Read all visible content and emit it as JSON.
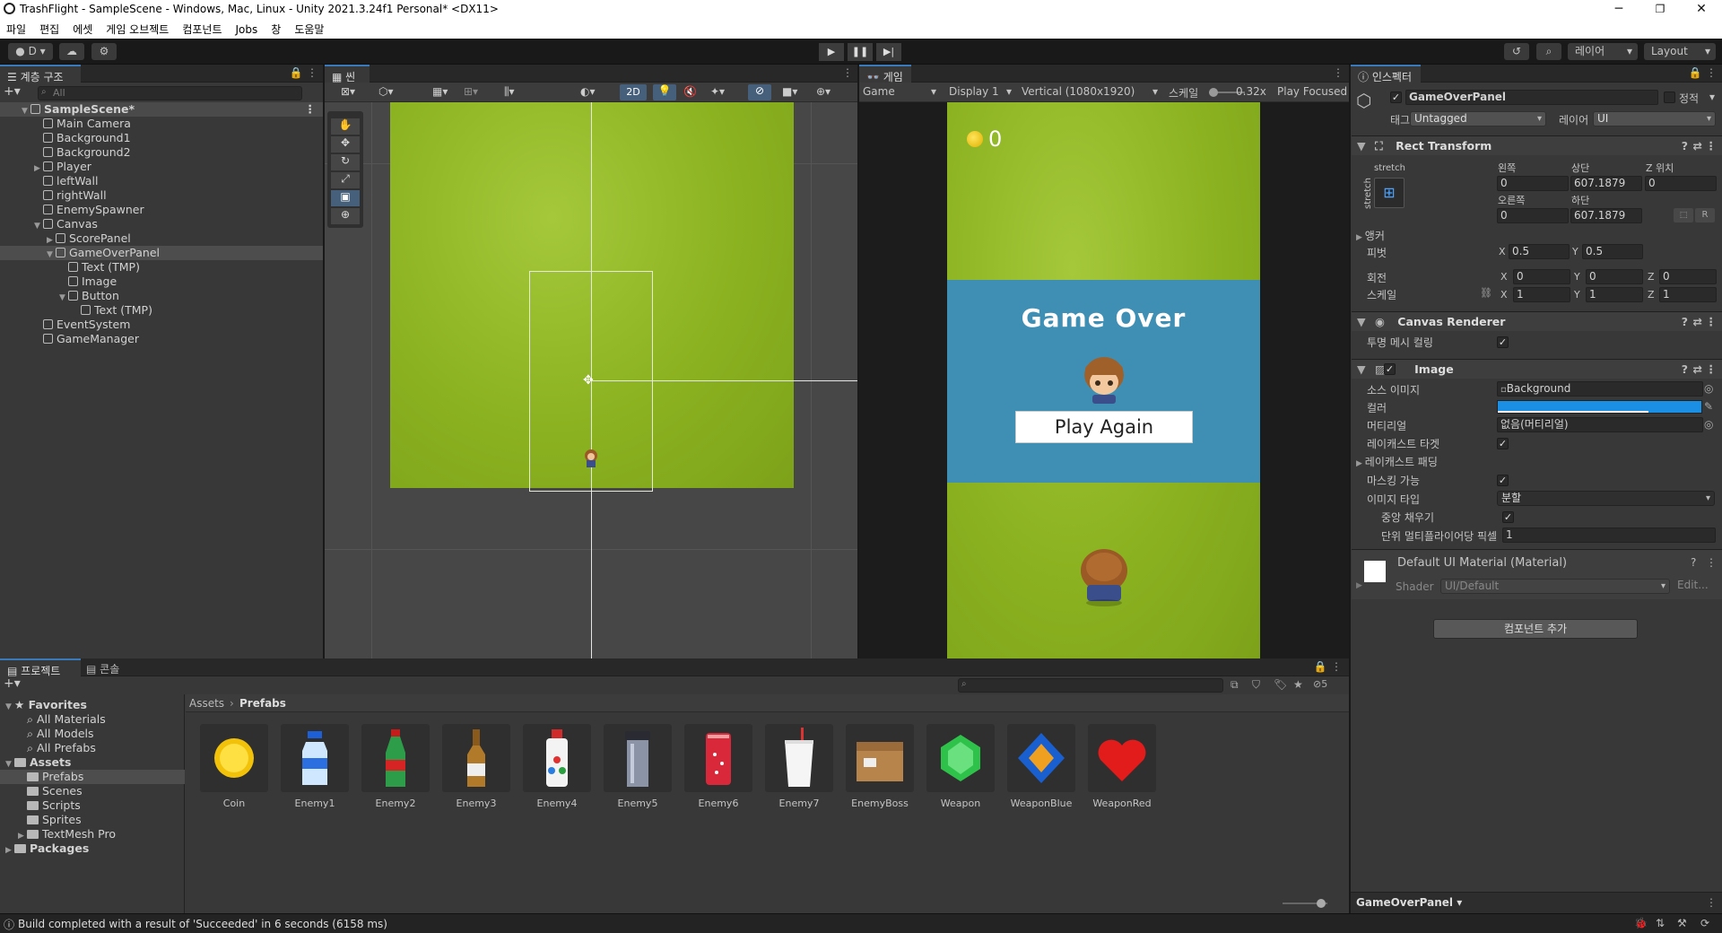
{
  "window": {
    "title": "TrashFlight - SampleScene - Windows, Mac, Linux - Unity 2021.3.24f1 Personal* <DX11>",
    "min": "─",
    "max": "❐",
    "close": "✕"
  },
  "menu": [
    "파일",
    "편집",
    "에셋",
    "게임 오브젝트",
    "컴포넌트",
    "Jobs",
    "창",
    "도움말"
  ],
  "toolbar": {
    "account": "D",
    "layers": "레이어",
    "layout": "Layout"
  },
  "hierarchy": {
    "tab": "계층 구조",
    "search_placeholder": "All",
    "items": [
      {
        "label": "SampleScene*",
        "indent": 0,
        "arrow": "▼",
        "scene": true
      },
      {
        "label": "Main Camera",
        "indent": 1,
        "arrow": ""
      },
      {
        "label": "Background1",
        "indent": 1,
        "arrow": ""
      },
      {
        "label": "Background2",
        "indent": 1,
        "arrow": ""
      },
      {
        "label": "Player",
        "indent": 1,
        "arrow": "▶"
      },
      {
        "label": "leftWall",
        "indent": 1,
        "arrow": ""
      },
      {
        "label": "rightWall",
        "indent": 1,
        "arrow": ""
      },
      {
        "label": "EnemySpawner",
        "indent": 1,
        "arrow": ""
      },
      {
        "label": "Canvas",
        "indent": 1,
        "arrow": "▼"
      },
      {
        "label": "ScorePanel",
        "indent": 2,
        "arrow": "▶"
      },
      {
        "label": "GameOverPanel",
        "indent": 2,
        "arrow": "▼",
        "selected": true
      },
      {
        "label": "Text (TMP)",
        "indent": 3,
        "arrow": ""
      },
      {
        "label": "Image",
        "indent": 3,
        "arrow": ""
      },
      {
        "label": "Button",
        "indent": 3,
        "arrow": "▼"
      },
      {
        "label": "Text (TMP)",
        "indent": 4,
        "arrow": ""
      },
      {
        "label": "EventSystem",
        "indent": 1,
        "arrow": ""
      },
      {
        "label": "GameManager",
        "indent": 1,
        "arrow": ""
      }
    ]
  },
  "scene": {
    "tab": "씬",
    "mode_2d": "2D"
  },
  "game": {
    "tab": "게임",
    "display_mode": "Game",
    "display": "Display 1",
    "resolution": "Vertical (1080x1920)",
    "scale_label": "스케일",
    "scale_value": "0.32x",
    "play_focused": "Play Focused",
    "coin_count": "0",
    "game_over": "Game Over",
    "play_again": "Play Again"
  },
  "inspector": {
    "tab": "인스펙터",
    "object_name": "GameOverPanel",
    "static": "정적",
    "tag_label": "태그",
    "tag_value": "Untagged",
    "layer_label": "레이어",
    "layer_value": "UI",
    "rect_transform": {
      "title": "Rect Transform",
      "stretch": "stretch",
      "stretch_v": "stretch",
      "left_label": "왼쪽",
      "top_label": "상단",
      "posz_label": "Z 위치",
      "right_label": "오른쪽",
      "bottom_label": "하단",
      "left": "0",
      "top": "607.1879",
      "posz": "0",
      "right": "0",
      "bottom": "607.1879",
      "anchor_label": "앵커",
      "pivot_label": "피벗",
      "pivot_x": "0.5",
      "pivot_y": "0.5",
      "rotation_label": "회전",
      "rot_x": "0",
      "rot_y": "0",
      "rot_z": "0",
      "scale_label": "스케일",
      "scale_x": "1",
      "scale_y": "1",
      "scale_z": "1",
      "r_button": "R"
    },
    "canvas_renderer": {
      "title": "Canvas Renderer",
      "cull_label": "투명 메시 컬링"
    },
    "image": {
      "title": "Image",
      "source_label": "소스 이미지",
      "source_value": "Background",
      "color_label": "컬러",
      "color": "#1a8fe3",
      "material_label": "머티리얼",
      "material_value": "없음(머티리얼)",
      "raycast_label": "레이캐스트 타겟",
      "raycast_pad_label": "레이캐스트 패딩",
      "maskable_label": "마스킹 가능",
      "type_label": "이미지 타입",
      "type_value": "분할",
      "fill_center_label": "중앙 채우기",
      "ppu_label": "단위 멀티플라이어당 픽셀",
      "ppu_value": "1"
    },
    "material": {
      "title": "Default UI Material (Material)",
      "shader_label": "Shader",
      "shader_value": "UI/Default",
      "edit": "Edit..."
    },
    "add_component": "컴포넌트 추가",
    "footer": "GameOverPanel"
  },
  "project": {
    "tab_project": "프로젝트",
    "tab_console": "콘솔",
    "breadcrumb_root": "Assets",
    "breadcrumb_leaf": "Prefabs",
    "count": "5",
    "tree": [
      {
        "label": "Favorites",
        "indent": 0,
        "arrow": "▼",
        "bold": true,
        "star": true
      },
      {
        "label": "All Materials",
        "indent": 1,
        "search": true
      },
      {
        "label": "All Models",
        "indent": 1,
        "search": true
      },
      {
        "label": "All Prefabs",
        "indent": 1,
        "search": true
      },
      {
        "label": "Assets",
        "indent": 0,
        "arrow": "▼",
        "bold": true,
        "folder": true
      },
      {
        "label": "Prefabs",
        "indent": 1,
        "folder": true,
        "selected": true
      },
      {
        "label": "Scenes",
        "indent": 1,
        "folder": true
      },
      {
        "label": "Scripts",
        "indent": 1,
        "folder": true
      },
      {
        "label": "Sprites",
        "indent": 1,
        "folder": true
      },
      {
        "label": "TextMesh Pro",
        "indent": 1,
        "folder": true,
        "arrow": "▶"
      },
      {
        "label": "Packages",
        "indent": 0,
        "arrow": "▶",
        "bold": true,
        "folder": true
      }
    ],
    "assets": [
      {
        "label": "Coin",
        "icon": "coin-icon"
      },
      {
        "label": "Enemy1",
        "icon": "water-bottle-icon"
      },
      {
        "label": "Enemy2",
        "icon": "cola-bottle-icon"
      },
      {
        "label": "Enemy3",
        "icon": "beer-bottle-icon"
      },
      {
        "label": "Enemy4",
        "icon": "spray-bottle-icon"
      },
      {
        "label": "Enemy5",
        "icon": "thermos-icon"
      },
      {
        "label": "Enemy6",
        "icon": "soda-can-icon"
      },
      {
        "label": "Enemy7",
        "icon": "paper-cup-icon"
      },
      {
        "label": "EnemyBoss",
        "icon": "cardboard-box-icon"
      },
      {
        "label": "Weapon",
        "icon": "green-gem-icon"
      },
      {
        "label": "WeaponBlue",
        "icon": "blue-gem-icon"
      },
      {
        "label": "WeaponRed",
        "icon": "heart-icon"
      }
    ]
  },
  "status": {
    "message": "Build completed with a result of 'Succeeded' in 6 seconds (6158 ms)"
  }
}
